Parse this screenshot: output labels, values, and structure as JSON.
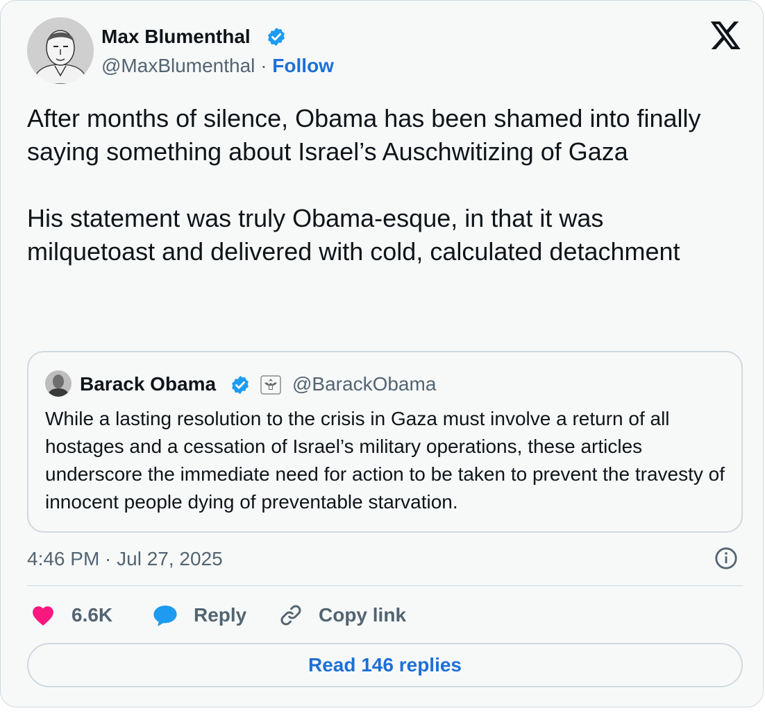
{
  "author": {
    "name": "Max Blumenthal",
    "handle": "@MaxBlumenthal",
    "separator": "·",
    "follow_label": "Follow",
    "verified": true
  },
  "tweet": {
    "paragraph_1": "After months of silence, Obama has been shamed into finally saying something about Israel’s Auschwitizing of Gaza",
    "paragraph_2": "His statement was truly Obama-esque, in that it was milquetoast and delivered with cold, calculated detachment"
  },
  "quoted_tweet": {
    "name": "Barack Obama",
    "handle": "@BarackObama",
    "verified": true,
    "text": "While a lasting resolution to the crisis in Gaza must involve a return of all hostages and a cessation of Israel’s military operations, these articles underscore the immediate need for action to be taken to prevent the travesty of innocent people dying of preventable starvation."
  },
  "timestamp": "4:46 PM · Jul 27, 2025",
  "actions": {
    "likes": "6.6K",
    "reply_label": "Reply",
    "copy_link_label": "Copy link"
  },
  "read_replies_label": "Read 146 replies",
  "icons": {
    "logo": "x-logo-icon",
    "verified": "verified-badge-icon",
    "like": "heart-icon",
    "reply": "speech-bubble-icon",
    "copy": "link-icon",
    "info": "info-icon",
    "seal": "government-seal-icon"
  },
  "colors": {
    "link_blue": "#1d6fd6",
    "verified_blue": "#1d9bf0",
    "heart_red": "#f91880",
    "muted_text": "#536471",
    "border": "#cfd9de",
    "card_bg": "#f7f9f9"
  }
}
